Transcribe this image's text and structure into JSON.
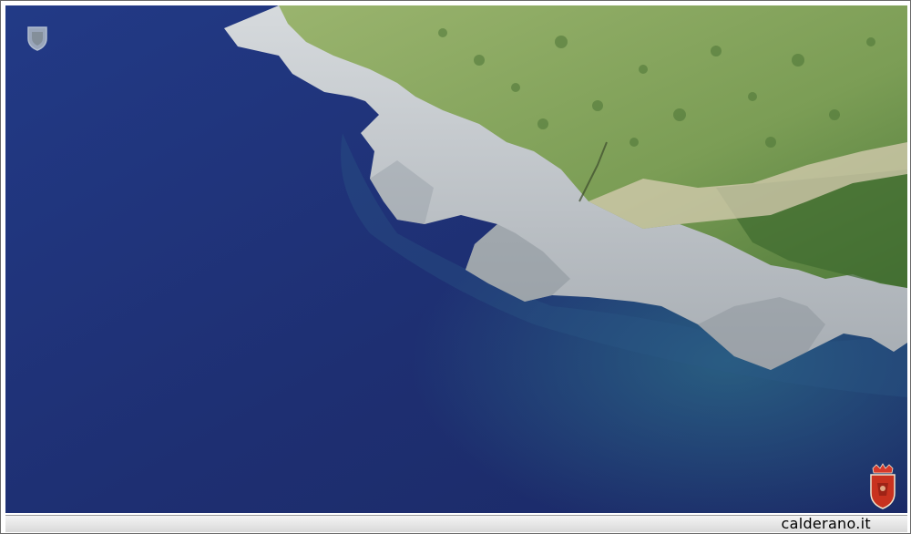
{
  "image": {
    "subject": "aerial-coastline",
    "colors": {
      "sea_deep": "#1f2f6e",
      "sea_mid": "#27408a",
      "sea_shallow": "#2f6a8a",
      "rock": "#c9ced3",
      "rock_shadow": "#8e969e",
      "vegetation": "#7fa05a",
      "vegetation_dark": "#4f7a3a",
      "frame_bar": "#e2e2e2"
    }
  },
  "watermark": {
    "site": "calderano.it"
  },
  "icons": {
    "top_left": "crest-icon",
    "bottom_right": "coat-of-arms-icon"
  }
}
